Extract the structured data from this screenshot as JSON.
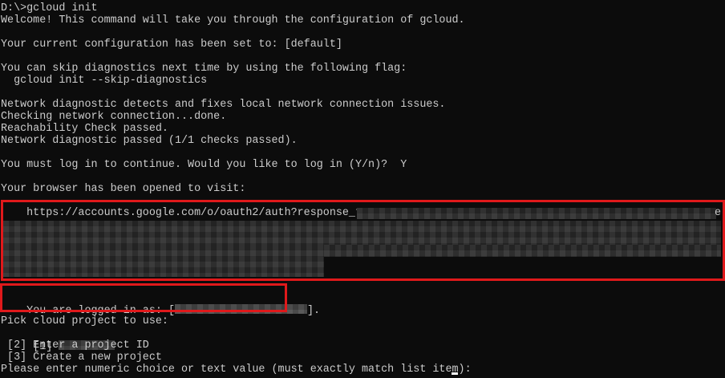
{
  "terminal": {
    "lines": {
      "cmd": "D:\\>gcloud init",
      "welcome": "Welcome! This command will take you through the configuration of gcloud.",
      "config": "Your current configuration has been set to: [default]",
      "skip": "You can skip diagnostics next time by using the following flag:",
      "skip_flag": "  gcloud init --skip-diagnostics",
      "net1": "Network diagnostic detects and fixes local network connection issues.",
      "net2": "Checking network connection...done.",
      "net3": "Reachability Check passed.",
      "net4": "Network diagnostic passed (1/1 checks passed).",
      "login_prompt": "You must log in to continue. Would you like to log in (Y/n)?  Y",
      "browser": "Your browser has been opened to visit:",
      "auth_url": "    https://accounts.google.com/o/oauth2/auth?response_type",
      "url_tail": "e",
      "logged_in_prefix": "You are logged in as: [",
      "logged_in_suffix": "].",
      "pick_project": "Pick cloud project to use:",
      "opt1": " [1] ",
      "opt2": " [2] Enter a project ID",
      "opt3": " [3] Create a new project",
      "choice": "Please enter numeric choice or text value (must exactly match list item):  "
    }
  },
  "colors": {
    "background": "#0c0c0c",
    "text": "#cccccc",
    "highlight": "#e0191b"
  }
}
